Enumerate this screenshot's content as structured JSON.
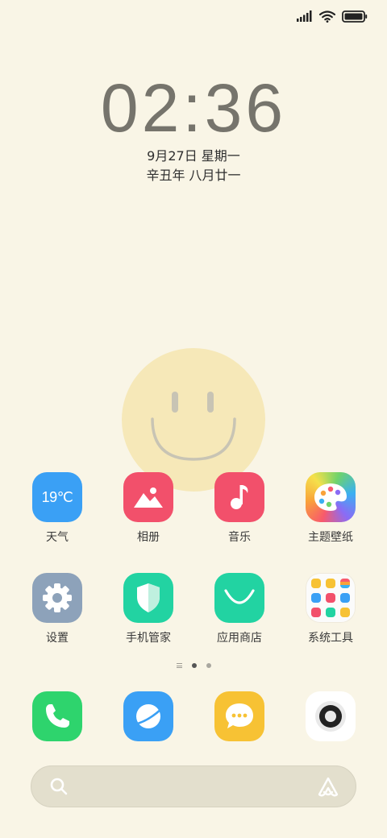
{
  "status_bar": {
    "icons": [
      "signal-icon",
      "wifi-icon",
      "battery-icon"
    ]
  },
  "lockscreen": {
    "time": "02:36",
    "date": "9月27日 星期一",
    "lunar_date": "辛丑年 八月廿一"
  },
  "apps": [
    {
      "label": "天气",
      "icon": "weather-icon",
      "temp": "19℃",
      "color": "#3aa0f5"
    },
    {
      "label": "相册",
      "icon": "gallery-icon",
      "color": "#f2506b"
    },
    {
      "label": "音乐",
      "icon": "music-icon",
      "color": "#f2506b"
    },
    {
      "label": "主题壁纸",
      "icon": "themes-palette-icon",
      "color": "#f7b64a"
    },
    {
      "label": "设置",
      "icon": "settings-gear-icon",
      "color": "#8da2ba"
    },
    {
      "label": "手机管家",
      "icon": "security-shield-icon",
      "color": "#22d3a2"
    },
    {
      "label": "应用商店",
      "icon": "app-store-icon",
      "color": "#22d3a2"
    },
    {
      "label": "系统工具",
      "icon": "system-tools-folder-icon",
      "color": "#fbfbfb"
    }
  ],
  "page_indicator": {
    "pages": 2,
    "current": 1
  },
  "dock": [
    {
      "icon": "phone-icon",
      "color": "#2ed46d"
    },
    {
      "icon": "browser-icon",
      "color": "#3aa0f5"
    },
    {
      "icon": "messages-icon",
      "color": "#f7c234"
    },
    {
      "icon": "camera-icon",
      "color": "#ffffff"
    }
  ],
  "search_bar": {
    "placeholder": "",
    "icons": [
      "search-icon",
      "assistant-icon"
    ]
  }
}
